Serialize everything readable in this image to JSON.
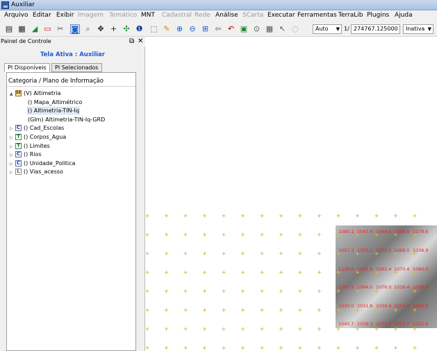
{
  "window": {
    "title": "Auxiliar"
  },
  "menu": [
    {
      "label": "Arquivo",
      "enabled": true
    },
    {
      "label": "Editar",
      "enabled": true
    },
    {
      "label": "Exibir",
      "enabled": true
    },
    {
      "label": "Imagem",
      "enabled": false
    },
    {
      "label": "Temático",
      "enabled": false
    },
    {
      "label": "MNT",
      "enabled": true
    },
    {
      "label": "Cadastral",
      "enabled": false
    },
    {
      "label": "Rede",
      "enabled": false
    },
    {
      "label": "Análise",
      "enabled": true
    },
    {
      "label": "SCarta",
      "enabled": false
    },
    {
      "label": "Executar",
      "enabled": true
    },
    {
      "label": "Ferramentas",
      "enabled": true
    },
    {
      "label": "TerraLib",
      "enabled": true
    },
    {
      "label": "Plugins",
      "enabled": true
    },
    {
      "label": "Ajuda",
      "enabled": true
    }
  ],
  "toolbar": {
    "icons": [
      "database-icon",
      "grid-icon",
      "draw-icon",
      "window-icon",
      "cut-icon",
      "info-icon",
      "zoom-icon",
      "pan-icon",
      "add-icon",
      "move-icon",
      "info-circle-icon",
      "select-icon",
      "pencil-icon",
      "zoom-in-icon",
      "zoom-out-icon",
      "zoom-area-icon",
      "back-icon",
      "redo-icon",
      "layers-icon",
      "search-icon",
      "table-icon",
      "cursor-icon",
      "lens-icon"
    ],
    "zoom_mode": "Auto",
    "scale_prefix": "1/",
    "scale_value": "274767.125000",
    "status_select": "Inativa"
  },
  "panel": {
    "title": "Painel de Controle",
    "active_view_label": "Tela Ativa : Auxiliar",
    "tabs": [
      {
        "label": "PI Disponíveis",
        "active": true
      },
      {
        "label": "PI Selecionados",
        "active": false
      }
    ],
    "tree_header": "Categoria / Plano de Informação",
    "tree": [
      {
        "label": "(V) Altimetria",
        "type": "M",
        "expander": "▲",
        "level": 0
      },
      {
        "label": "() Mapa_Altimétrico",
        "type": "",
        "expander": "",
        "level": 1
      },
      {
        "label": "() Altimetria-TIN-Iq",
        "type": "",
        "expander": "",
        "level": 1,
        "selected": true
      },
      {
        "label": "(GIm) Altimetria-TIN-Iq-GRD",
        "type": "",
        "expander": "",
        "level": 1
      },
      {
        "label": "() Cad_Escolas",
        "type": "C",
        "expander": "▷",
        "level": 0
      },
      {
        "label": "() Corpos_Agua",
        "type": "T",
        "expander": "▷",
        "level": 0
      },
      {
        "label": "() Limites",
        "type": "T",
        "expander": "▷",
        "level": 0
      },
      {
        "label": "() Rios",
        "type": "C",
        "expander": "▷",
        "level": 0
      },
      {
        "label": "() Unidade_Politica",
        "type": "C",
        "expander": "▷",
        "level": 0
      },
      {
        "label": "() Vias_acesso",
        "type": "L",
        "expander": "▷",
        "level": 0
      }
    ]
  },
  "map": {
    "grid_color": "#e0b830",
    "label_color": "#ff1a1a",
    "elevation_labels": [
      [
        "1080.1",
        "1047.4",
        "1068.0",
        "1096.8",
        "1178.6"
      ],
      [
        "1057.3",
        "1055.1",
        "1070.0",
        "1068.0",
        "1038.9"
      ],
      [
        "1130.0",
        "1151.9",
        "1092.4",
        "1070.4",
        "1080.0"
      ],
      [
        "1107.5",
        "1094.0",
        "1076.0",
        "1026.4",
        "1038.5"
      ],
      [
        "1030.0",
        "1031.8",
        "1034.4",
        "1050.6",
        "1042.5"
      ],
      [
        "1040.7",
        "1039.3",
        "1035.2",
        "1050.2",
        "1122.6"
      ]
    ]
  }
}
